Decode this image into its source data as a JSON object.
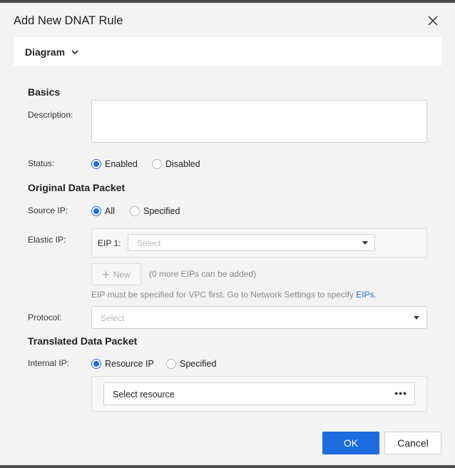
{
  "dialog": {
    "title": "Add New DNAT Rule",
    "close_icon": "close-icon"
  },
  "diagram": {
    "label": "Diagram",
    "icon": "chevron-down-icon"
  },
  "basics": {
    "heading": "Basics",
    "description_label": "Description:",
    "description_value": "",
    "status_label": "Status:",
    "status_options": [
      "Enabled",
      "Disabled"
    ],
    "status_selected": "Enabled"
  },
  "original": {
    "heading": "Original Data Packet",
    "source_ip_label": "Source IP:",
    "source_ip_options": [
      "All",
      "Specified"
    ],
    "source_ip_selected": "All",
    "elastic_ip_label": "Elastic IP:",
    "eip1_label": "EIP 1:",
    "eip1_placeholder": "Select",
    "new_button": "New",
    "new_hint": "(0 more EIPs can be added)",
    "eip_hint": "EIP must be specified for VPC first. Go to Network Settings to specify",
    "eip_link": "EIPs",
    "eip_hint_end": ".",
    "protocol_label": "Protocol:",
    "protocol_placeholder": "Select"
  },
  "translated": {
    "heading": "Translated Data Packet",
    "internal_ip_label": "Internal IP:",
    "internal_ip_options": [
      "Resource IP",
      "Specified"
    ],
    "internal_ip_selected": "Resource IP",
    "select_resource": "Select resource",
    "more_icon": "more-dots-icon"
  },
  "footer": {
    "ok": "OK",
    "cancel": "Cancel"
  },
  "colors": {
    "accent": "#1d6ce0",
    "background": "#f3f3f4"
  }
}
